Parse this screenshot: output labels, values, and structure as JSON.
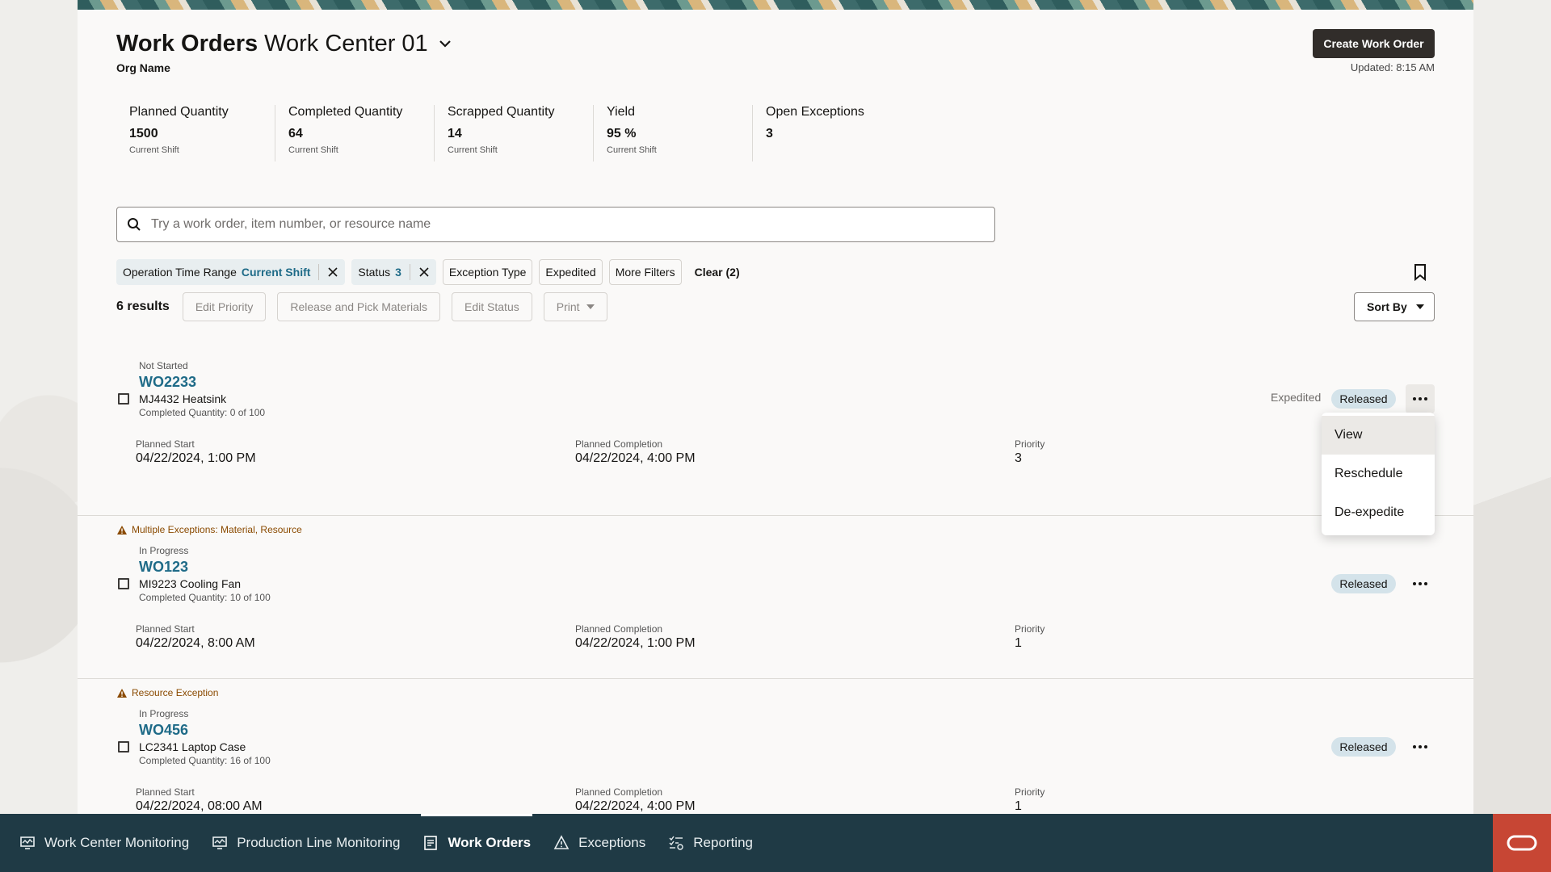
{
  "header": {
    "title": "Work Orders",
    "work_center": "Work Center 01",
    "org_name": "Org Name",
    "create_button": "Create Work Order",
    "updated": "Updated: 8:15 AM"
  },
  "metrics": [
    {
      "label": "Planned Quantity",
      "value": "1500",
      "sub": "Current Shift"
    },
    {
      "label": "Completed Quantity",
      "value": "64",
      "sub": "Current Shift"
    },
    {
      "label": "Scrapped Quantity",
      "value": "14",
      "sub": "Current Shift"
    },
    {
      "label": "Yield",
      "value": "95 %",
      "sub": "Current Shift"
    },
    {
      "label": "Open Exceptions",
      "value": "3",
      "sub": ""
    }
  ],
  "search": {
    "placeholder": "Try a work order, item number, or resource name"
  },
  "filters": {
    "op_time_label": "Operation Time Range",
    "op_time_value": "Current Shift",
    "status_label": "Status",
    "status_value": "3",
    "exception_type": "Exception Type",
    "expedited": "Expedited",
    "more_filters": "More Filters",
    "clear": "Clear (2)"
  },
  "toolbar": {
    "results": "6 results",
    "edit_priority": "Edit Priority",
    "release_pick": "Release and Pick Materials",
    "edit_status": "Edit Status",
    "print": "Print",
    "sort_by": "Sort By"
  },
  "labels": {
    "planned_start": "Planned Start",
    "planned_completion": "Planned Completion",
    "priority": "Priority"
  },
  "work_orders": [
    {
      "exception": "",
      "status": "Not Started",
      "id": "WO2233",
      "item": "MJ4432 Heatsink",
      "qty": "Completed Quantity: 0 of 100",
      "planned_start": "04/22/2024, 1:00 PM",
      "planned_completion": "04/22/2024, 4:00 PM",
      "priority": "3",
      "expedited": "Expedited",
      "badge": "Released"
    },
    {
      "exception": "Multiple Exceptions: Material, Resource",
      "status": "In Progress",
      "id": "WO123",
      "item": "MI9223 Cooling Fan",
      "qty": "Completed Quantity: 10 of 100",
      "planned_start": "04/22/2024, 8:00 AM",
      "planned_completion": "04/22/2024, 1:00 PM",
      "priority": "1",
      "expedited": "",
      "badge": "Released"
    },
    {
      "exception": "Resource Exception",
      "status": "In Progress",
      "id": "WO456",
      "item": "LC2341 Laptop Case",
      "qty": "Completed Quantity: 16 of 100",
      "planned_start": "04/22/2024, 08:00 AM",
      "planned_completion": "04/22/2024, 4:00 PM",
      "priority": "1",
      "expedited": "",
      "badge": "Released"
    }
  ],
  "context_menu": [
    "View",
    "Reschedule",
    "De-expedite"
  ],
  "nav": [
    {
      "label": "Work Center Monitoring",
      "icon": "monitor-icon"
    },
    {
      "label": "Production Line Monitoring",
      "icon": "monitor-icon"
    },
    {
      "label": "Work Orders",
      "icon": "document-icon",
      "active": true
    },
    {
      "label": "Exceptions",
      "icon": "warning-icon"
    },
    {
      "label": "Reporting",
      "icon": "checklist-icon"
    }
  ],
  "colors": {
    "accent": "#1f6b88",
    "nav_bg": "#1f3a45",
    "badge_bg": "#d4e3ea",
    "brand": "#c74634",
    "warning": "#8a4a00"
  }
}
